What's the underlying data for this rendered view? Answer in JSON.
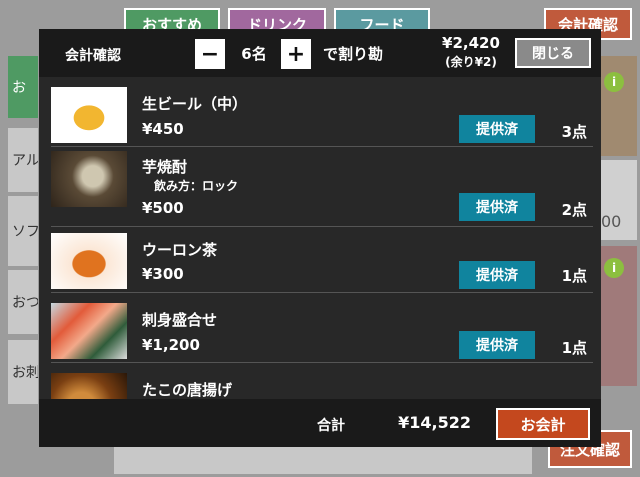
{
  "background": {
    "tabs": {
      "recommend": "おすすめ",
      "drink": "ドリンク",
      "food": "フード",
      "checkout": "会計確認"
    },
    "sidebar": [
      "お",
      "アル",
      "ソフト",
      "おつ",
      "お刺"
    ],
    "price_hint": "00",
    "order_confirm": "注文確認",
    "info_icon": "i"
  },
  "modal": {
    "title": "会計確認",
    "minus_label": "−",
    "plus_label": "+",
    "people": "6名",
    "split_label": "で割り勘",
    "per_person": "¥2,420",
    "remainder": "(余り¥2)",
    "close_label": "閉じる",
    "items": [
      {
        "name": "生ビール（中）",
        "price": "¥450",
        "status": "提供済",
        "qty": "3点",
        "image_icon": "beer-image"
      },
      {
        "name": "芋焼酎",
        "option": "飲み方：ロック",
        "price": "¥500",
        "status": "提供済",
        "qty": "2点",
        "image_icon": "shochu-image"
      },
      {
        "name": "ウーロン茶",
        "price": "¥300",
        "status": "提供済",
        "qty": "1点",
        "image_icon": "oolong-image"
      },
      {
        "name": "刺身盛合せ",
        "price": "¥1,200",
        "status": "提供済",
        "qty": "1点",
        "image_icon": "sashimi-image"
      },
      {
        "name": "たこの唐揚げ",
        "image_icon": "fried-octopus-image"
      }
    ],
    "total_label": "合計",
    "total_amount": "¥14,522",
    "pay_label": "お会計"
  },
  "colors": {
    "status_badge": "#10849e",
    "pay_button": "#c4481e",
    "modal_bg": "#282828",
    "header_bg": "#1a1a1a"
  }
}
